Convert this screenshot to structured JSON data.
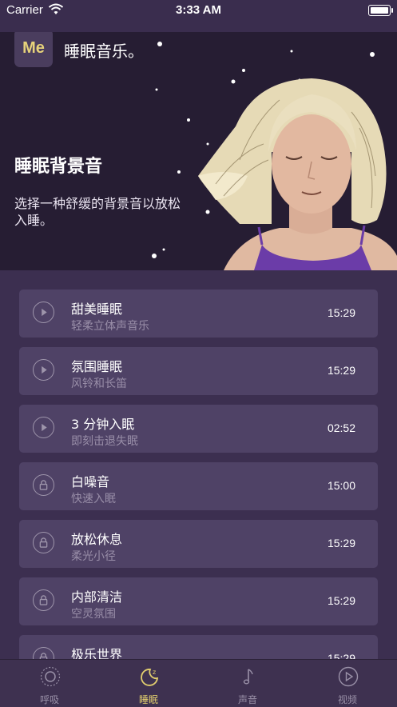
{
  "status_bar": {
    "carrier": "Carrier",
    "time": "3:33 AM"
  },
  "header": {
    "logo_text": "Me",
    "app_title": "睡眠音乐。"
  },
  "hero": {
    "title": "睡眠背景音",
    "subtitle": "选择一种舒缓的背景音以放松入睡。"
  },
  "sessions": [
    {
      "title": "甜美睡眠",
      "subtitle": "轻柔立体声音乐",
      "duration": "15:29",
      "icon": "play-icon",
      "locked": false
    },
    {
      "title": "氛围睡眠",
      "subtitle": "风铃和长笛",
      "duration": "15:29",
      "icon": "play-icon",
      "locked": false
    },
    {
      "title": "3 分钟入眠",
      "subtitle": "即刻击退失眠",
      "duration": "02:52",
      "icon": "play-icon",
      "locked": false
    },
    {
      "title": "白噪音",
      "subtitle": "快速入眠",
      "duration": "15:00",
      "icon": "lock-icon",
      "locked": true
    },
    {
      "title": "放松休息",
      "subtitle": "柔光小径",
      "duration": "15:29",
      "icon": "lock-icon",
      "locked": true
    },
    {
      "title": "内部清洁",
      "subtitle": "空灵氛围",
      "duration": "15:29",
      "icon": "lock-icon",
      "locked": true
    },
    {
      "title": "极乐世界",
      "subtitle": "",
      "duration": "15:29",
      "icon": "lock-icon",
      "locked": true
    }
  ],
  "tabs": [
    {
      "label": "呼吸",
      "icon": "breath-icon",
      "active": false
    },
    {
      "label": "睡眠",
      "icon": "moon-icon",
      "active": true
    },
    {
      "label": "声音",
      "icon": "music-note-icon",
      "active": false
    },
    {
      "label": "视频",
      "icon": "play-circle-icon",
      "active": false
    }
  ],
  "colors": {
    "background": "#3c2f50",
    "hero_background": "#261d33",
    "card": "#4f4266",
    "accent": "#e3cf6e",
    "muted_text": "#998ea8"
  }
}
